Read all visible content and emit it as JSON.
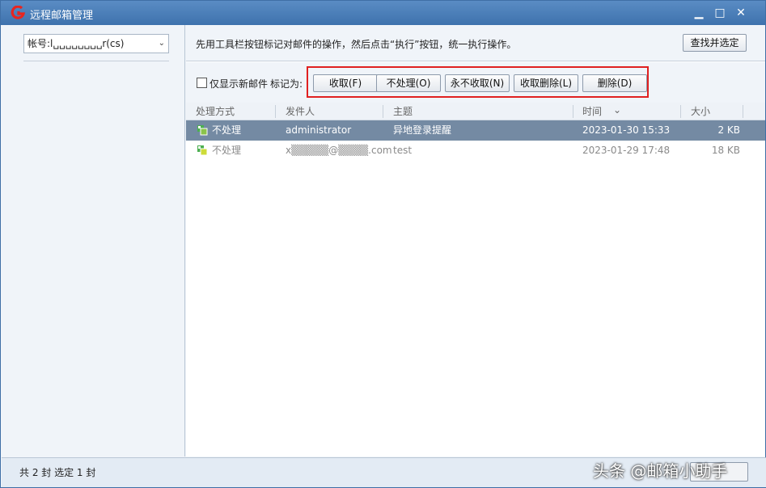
{
  "window": {
    "title": "远程邮箱管理",
    "controls": {
      "minimize": "▁",
      "maximize": "□",
      "close": "✕"
    }
  },
  "left": {
    "account_value": "帐号:l␣␣␣␣␣␣␣␣r(cs)"
  },
  "hint": {
    "text": "先用工具栏按钮标记对邮件的操作，然后点击“执行”按钮，统一执行操作。",
    "find_button": "查找并选定"
  },
  "mark_bar": {
    "only_new_label": "仅显示新邮件",
    "mark_as_label": "标记为:",
    "buttons": [
      {
        "label": "收取(F)"
      },
      {
        "label": "不处理(O)"
      },
      {
        "label": "永不收取(N)"
      },
      {
        "label": "收取删除(L)"
      },
      {
        "label": "删除(D)"
      }
    ]
  },
  "columns": {
    "action": "处理方式",
    "sender": "发件人",
    "subject": "主题",
    "time": "时间",
    "time_sort_icon": "⌄",
    "size": "大小"
  },
  "rows": [
    {
      "action": "不处理",
      "sender": "administrator",
      "subject": "异地登录提醒",
      "time": "2023-01-30 15:33",
      "size": "2 KB"
    },
    {
      "action": "不处理",
      "sender": "x▒▒▒▒▒@▒▒▒▒.com",
      "subject": "test",
      "time": "2023-01-29 17:48",
      "size": "18 KB"
    }
  ],
  "status": {
    "text": "共 2 封  选定 1 封",
    "watermark": "头条 @邮箱小助手"
  },
  "colors": {
    "titlebar": "#3e72ad",
    "selected_row": "#748aa3",
    "highlight": "#e02020"
  }
}
